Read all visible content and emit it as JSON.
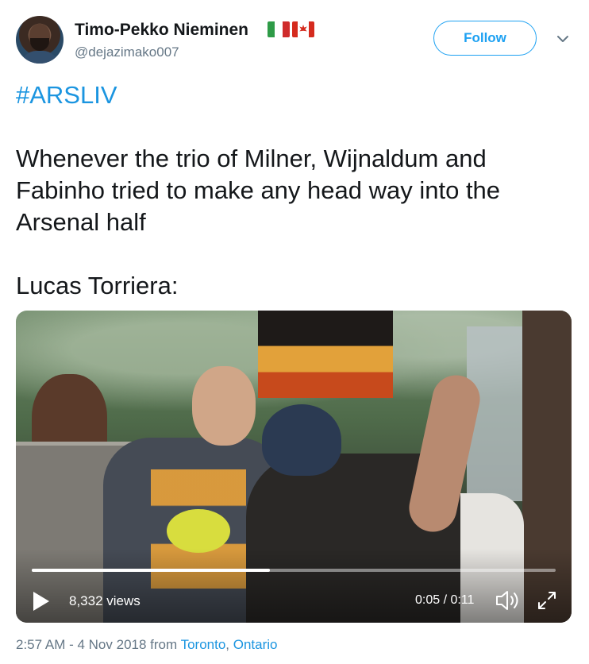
{
  "user": {
    "name": "Timo-Pekko Nieminen",
    "handle": "@dejazimako007"
  },
  "follow_label": "Follow",
  "tweet": {
    "hashtag": "#ARSLIV",
    "line1": "Whenever the trio of Milner, Wijnaldum and",
    "line2": "Fabinho tried to make any head way into the",
    "line3": "Arsenal half",
    "line4": "Lucas Torriera:"
  },
  "video": {
    "views": "8,332 views",
    "time": "0:05 / 0:11",
    "progress": 0.455
  },
  "footer": {
    "timestamp": "2:57 AM - 4 Nov 2018 from",
    "location_city": "Toronto",
    "location_sep": ", ",
    "location_region": "Ontario"
  },
  "colors": {
    "accent": "#1da1f2",
    "link": "#1b95e0",
    "secondary_text": "#657786"
  }
}
